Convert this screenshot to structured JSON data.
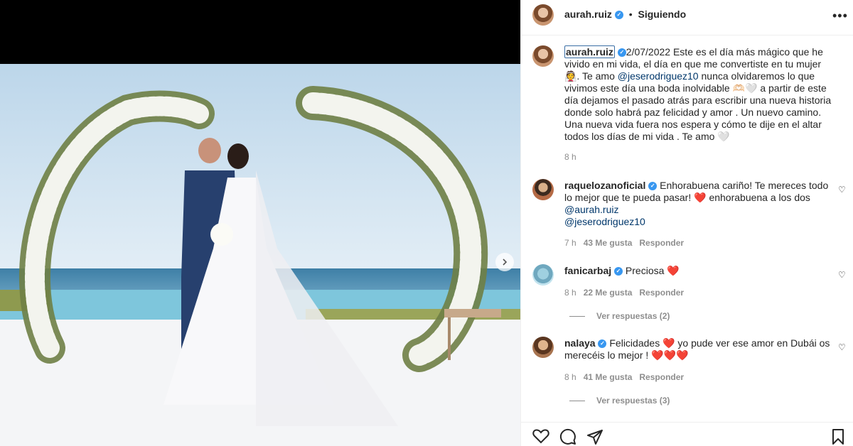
{
  "header": {
    "username": "aurah.ruiz",
    "separator": "•",
    "follow_status": "Siguiendo",
    "more_icon": "more-horizontal-icon"
  },
  "caption": {
    "username": "aurah.ruiz",
    "text_1": "2/07/2022 Este es el día más mágico que he vivido en mi vida, el día en que me convertiste en tu mujer 👰. Te amo ",
    "mention": "@jeserodriguez10",
    "text_2": " nunca olvidaremos lo que vivimos este día una boda inolvidable 🫶🏻🤍 a partir de este día dejamos el pasado atrás para escribir una nueva historia donde solo habrá paz felicidad y amor . Un nuevo camino. Una nueva vida fuera nos espera y cómo te dije en el altar todos los días de mi vida . Te amo 🤍",
    "time": "8 h"
  },
  "comments": [
    {
      "username": "raquelozanoficial",
      "text": "Enhorabuena cariño! Te mereces todo lo mejor que te pueda pasar! ❤️ enhorabuena a los dos",
      "mention_1": "@aurah.ruiz",
      "mention_2": "@jeserodriguez10",
      "time": "7 h",
      "likes": "43 Me gusta",
      "reply": "Responder"
    },
    {
      "username": "fanicarbaj",
      "text": "Preciosa ❤️",
      "time": "8 h",
      "likes": "22 Me gusta",
      "reply": "Responder",
      "view_replies": "Ver respuestas (2)"
    },
    {
      "username": "nalaya",
      "text": "Felicidades ❤️ yo pude ver ese amor en Dubái os merecéis lo mejor ! ❤️❤️❤️",
      "time": "8 h",
      "likes": "41 Me gusta",
      "reply": "Responder",
      "view_replies": "Ver respuestas (3)"
    }
  ],
  "actions": [
    "heart-icon",
    "comment-icon",
    "share-icon",
    "bookmark-icon"
  ],
  "colors": {
    "accent": "#3897f0",
    "mention": "#00376b",
    "muted": "#8e8e8e",
    "heart": "#e0102b"
  }
}
